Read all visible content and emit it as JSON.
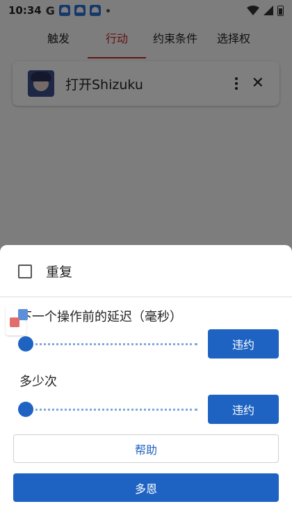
{
  "status_bar": {
    "time": "10:34",
    "google_letter": "G"
  },
  "tabs": [
    {
      "label": "触发"
    },
    {
      "label": "行动",
      "active": true
    },
    {
      "label": "约束条件"
    },
    {
      "label": "选择权"
    }
  ],
  "action_card": {
    "title": "打开Shizuku"
  },
  "sheet": {
    "repeat_label": "重复",
    "repeat_checked": false,
    "delay": {
      "label": "下一个操作前的延迟（毫秒）",
      "slider_fraction": 0.0,
      "default_button": "违约"
    },
    "count": {
      "label": "多少次",
      "slider_fraction": 0.0,
      "default_button": "违约"
    },
    "help_button": "帮助",
    "done_button": "多恩"
  },
  "colors": {
    "accent": "#1f63c2",
    "tab_active": "#c62828"
  }
}
